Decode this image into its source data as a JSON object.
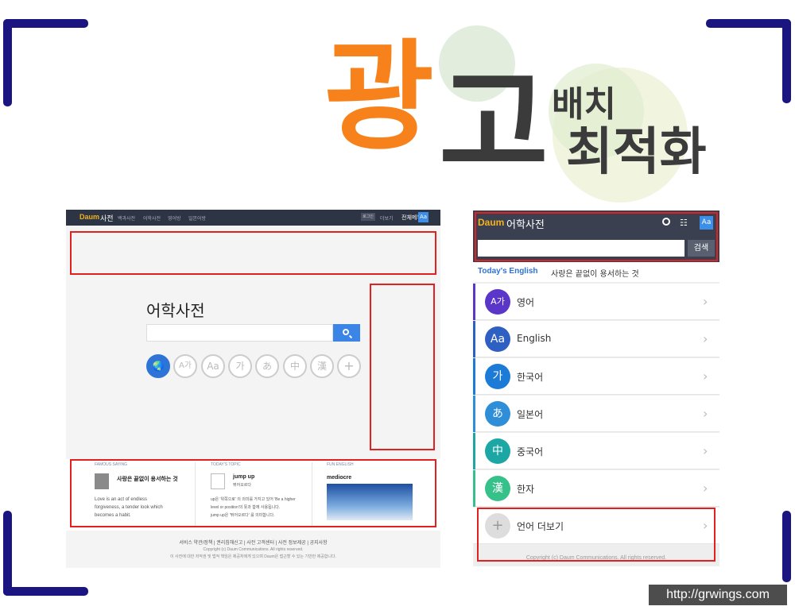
{
  "title": {
    "big1": "광",
    "big2": "고",
    "small1": "배치",
    "small2": "최적화",
    "color_orange": "#f7821b",
    "color_dark": "#3b3b3b"
  },
  "desktop": {
    "logo": "Daum",
    "service": "사전",
    "nav": [
      "백과사전",
      "어학사전",
      "영어방",
      "일본어방"
    ],
    "login": "로그인",
    "more": "더보기",
    "all_service": "전체메뉴",
    "font_icon": "Aa",
    "dict_title": "어학사전",
    "lang_icons": [
      "globe-icon",
      "A가",
      "Aa",
      "가",
      "あ",
      "中",
      "漢",
      "+"
    ],
    "columns": [
      {
        "label": "FAMOUS SAYING",
        "head": "사랑은 끝없이 용서하는 것",
        "text": [
          "Love is an act of endless",
          "forgiveness, a tender look which",
          "becomes a habit."
        ]
      },
      {
        "label": "TODAY'S TOPIC",
        "head": "jump up",
        "sub": "뛰어오르다",
        "text": [
          "up은 '위쪽으로' 의 의미를 가지고 있어 'Be a higher",
          "level or position'의 뜻과 함께 사용됩니다.",
          "jump up은 '뛰어오르다' 를 의미합니다."
        ]
      },
      {
        "label": "FUN ENGLISH",
        "head": "mediocre"
      }
    ],
    "footer_links": "서비스 약관/정책 | 권리침해신고 | 사전 고객센터 | 사전 정보제공 | 공지사항",
    "footer_copy": "Copyright (c) Daum Communications. All rights reserved.",
    "footer_note": "이 사전에 대한 저작권 및 법적 책임은 제공처에게 있으며 Daum은 접근할 수 있는 기반만 제공합니다."
  },
  "mobile": {
    "logo": "Daum",
    "title": "어학사전",
    "search_button": "검색",
    "font_icon": "Aa",
    "today_label": "Today's English",
    "today_text": "사랑은 끝없이 용서하는 것",
    "rows": [
      {
        "icon": "A가",
        "label": "영어",
        "color": "#5a36c9"
      },
      {
        "icon": "Aa",
        "label": "English",
        "color": "#2e5fc2"
      },
      {
        "icon": "가",
        "label": "한국어",
        "color": "#1b7bd6"
      },
      {
        "icon": "あ",
        "label": "일본어",
        "color": "#2f8ed8"
      },
      {
        "icon": "中",
        "label": "중국어",
        "color": "#1ca7a5"
      },
      {
        "icon": "漢",
        "label": "한자",
        "color": "#36c18a"
      },
      {
        "icon": "+",
        "label": "언어 더보기",
        "color": "#dddddd"
      }
    ],
    "copyright": "Copyright (c) Daum Communications. All rights reserved."
  },
  "url": "http://grwings.com"
}
